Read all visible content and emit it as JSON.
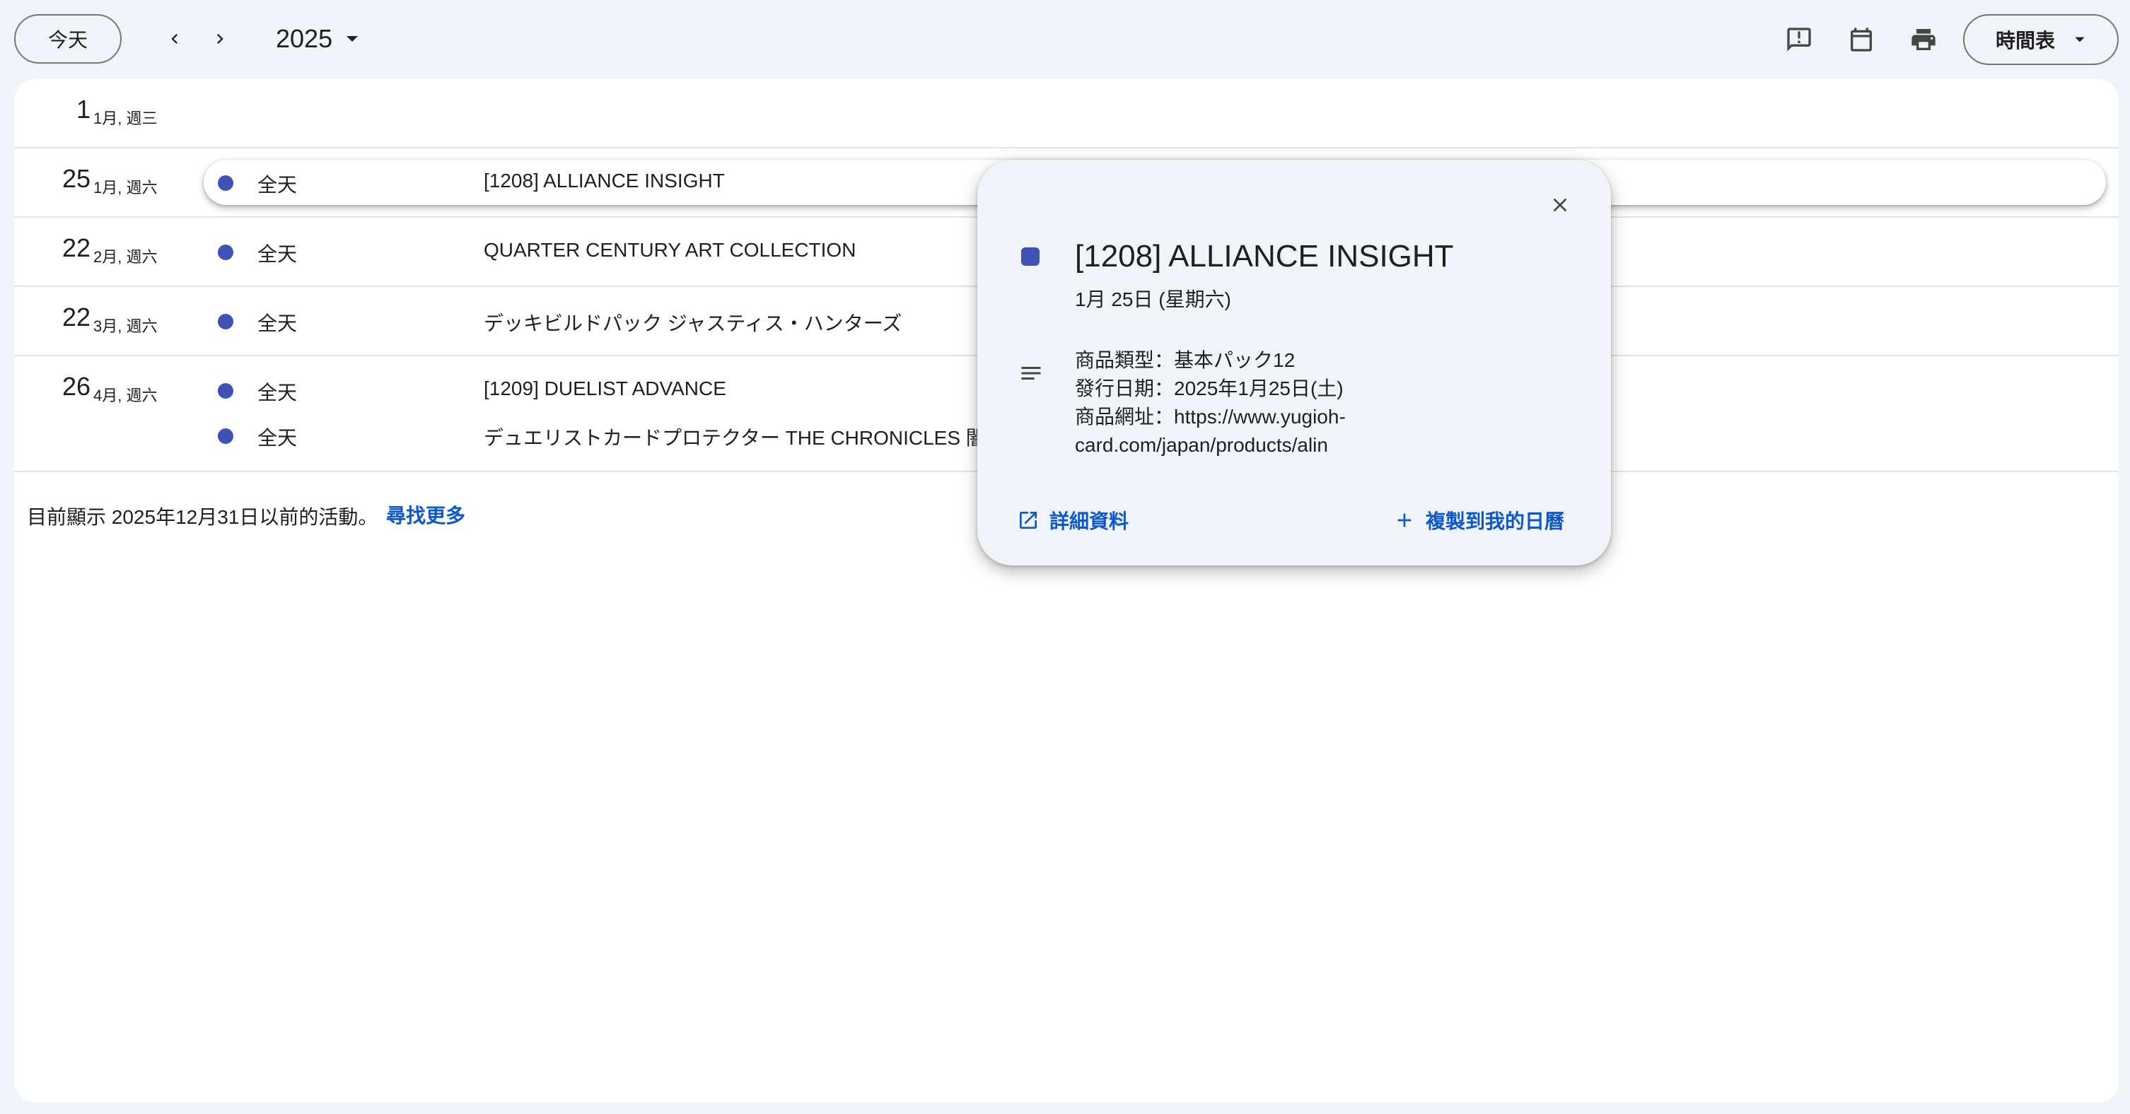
{
  "toolbar": {
    "today_label": "今天",
    "year_label": "2025",
    "view_label": "時間表"
  },
  "icons": {
    "prev": "chevron-left-icon",
    "next": "chevron-right-icon",
    "year_dropdown": "caret-down-icon",
    "feedback": "feedback-icon",
    "calendar": "calendar-icon",
    "print": "print-icon",
    "view_dropdown": "caret-down-icon",
    "close": "close-icon",
    "description": "notes-icon",
    "open": "open-in-new-icon",
    "add": "plus-icon"
  },
  "colors": {
    "event_dot": "#3f51b5",
    "link": "#0b57d0",
    "background": "#f0f4f9"
  },
  "days": [
    {
      "num": "1",
      "sub": "1月, 週三",
      "events": []
    },
    {
      "num": "25",
      "sub": "1月, 週六",
      "events": [
        {
          "time": "全天",
          "title": "[1208] ALLIANCE INSIGHT",
          "highlighted": true
        }
      ]
    },
    {
      "num": "22",
      "sub": "2月, 週六",
      "events": [
        {
          "time": "全天",
          "title": "QUARTER CENTURY ART COLLECTION"
        }
      ]
    },
    {
      "num": "22",
      "sub": "3月, 週六",
      "events": [
        {
          "time": "全天",
          "title": "デッキビルドパック ジャスティス・ハンターズ"
        }
      ]
    },
    {
      "num": "26",
      "sub": "4月, 週六",
      "events": [
        {
          "time": "全天",
          "title": "[1209] DUELIST ADVANCE"
        },
        {
          "time": "全天",
          "title": "デュエリストカードプロテクター THE CHRONICLES 闇"
        }
      ]
    }
  ],
  "footer": {
    "note": "目前顯示 2025年12月31日以前的活動。",
    "find_more": "尋找更多"
  },
  "popup": {
    "title": "[1208] ALLIANCE INSIGHT",
    "date": "1月 25日 (星期六)",
    "description_lines": [
      "商品類型：基本パック12",
      "發行日期：2025年1月25日(土)",
      "商品網址：https://www.yugioh-",
      "card.com/japan/products/alin"
    ],
    "details_label": "詳細資料",
    "copy_label": "複製到我的日曆"
  }
}
